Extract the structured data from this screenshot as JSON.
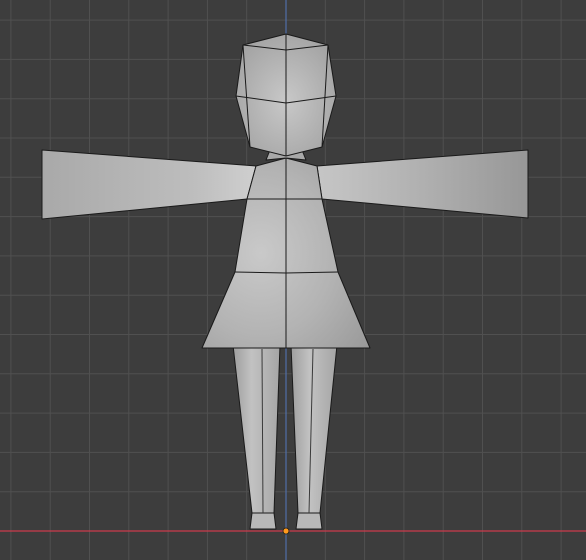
{
  "viewport": {
    "view": "front-orthographic",
    "background_color": "#3d3d3d",
    "grid_minor_color": "#464646",
    "grid_major_color": "#505050",
    "x_axis_color": "#cc3b4b",
    "z_axis_color": "#4f6fa8",
    "origin_color": "#ff9a1c",
    "mesh": {
      "name_icon": "mannequin-mesh",
      "shading": "solid",
      "parts": [
        "head",
        "left-arm",
        "right-arm",
        "torso-dress",
        "left-leg",
        "right-leg",
        "left-foot",
        "right-foot"
      ]
    }
  }
}
